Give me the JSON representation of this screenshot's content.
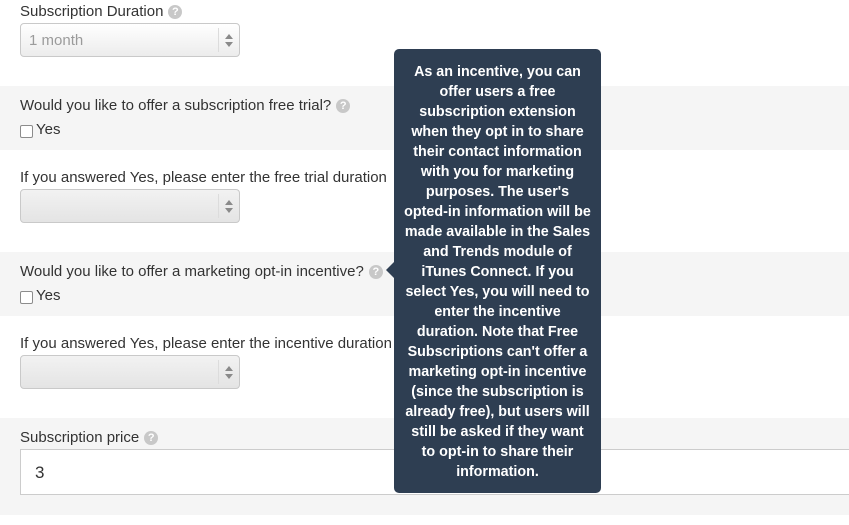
{
  "duration": {
    "label": "Subscription Duration",
    "help_icon": "question-circle-icon",
    "selected": "1 month"
  },
  "free_trial": {
    "question": "Would you like to offer a subscription free trial?",
    "help_icon": "question-circle-icon",
    "checkbox_label": "Yes",
    "duration_label": "If you answered Yes, please enter the free trial duration",
    "selected": ""
  },
  "opt_in": {
    "question": "Would you like to offer a marketing opt-in incentive?",
    "help_icon": "question-circle-icon",
    "checkbox_label": "Yes",
    "duration_label": "If you answered Yes, please enter the incentive duration",
    "selected": ""
  },
  "price": {
    "label": "Subscription price",
    "help_icon": "question-circle-icon",
    "value": "3"
  },
  "tooltip": {
    "text": "As an incentive, you can offer users a free subscription extension when they opt in to share their contact information with you for marketing purposes. The user's opted-in information will be made available in the Sales and Trends module of iTunes Connect. If you select Yes, you will need to enter the incentive duration. Note that Free Subscriptions can't offer a marketing opt-in incentive (since the subscription is already free), but users will still be asked if they want to opt-in to share their information."
  },
  "colors": {
    "tooltip_bg": "#2e3e52",
    "shaded_bg": "#f5f5f5",
    "help_icon": "#c8c8c8"
  }
}
